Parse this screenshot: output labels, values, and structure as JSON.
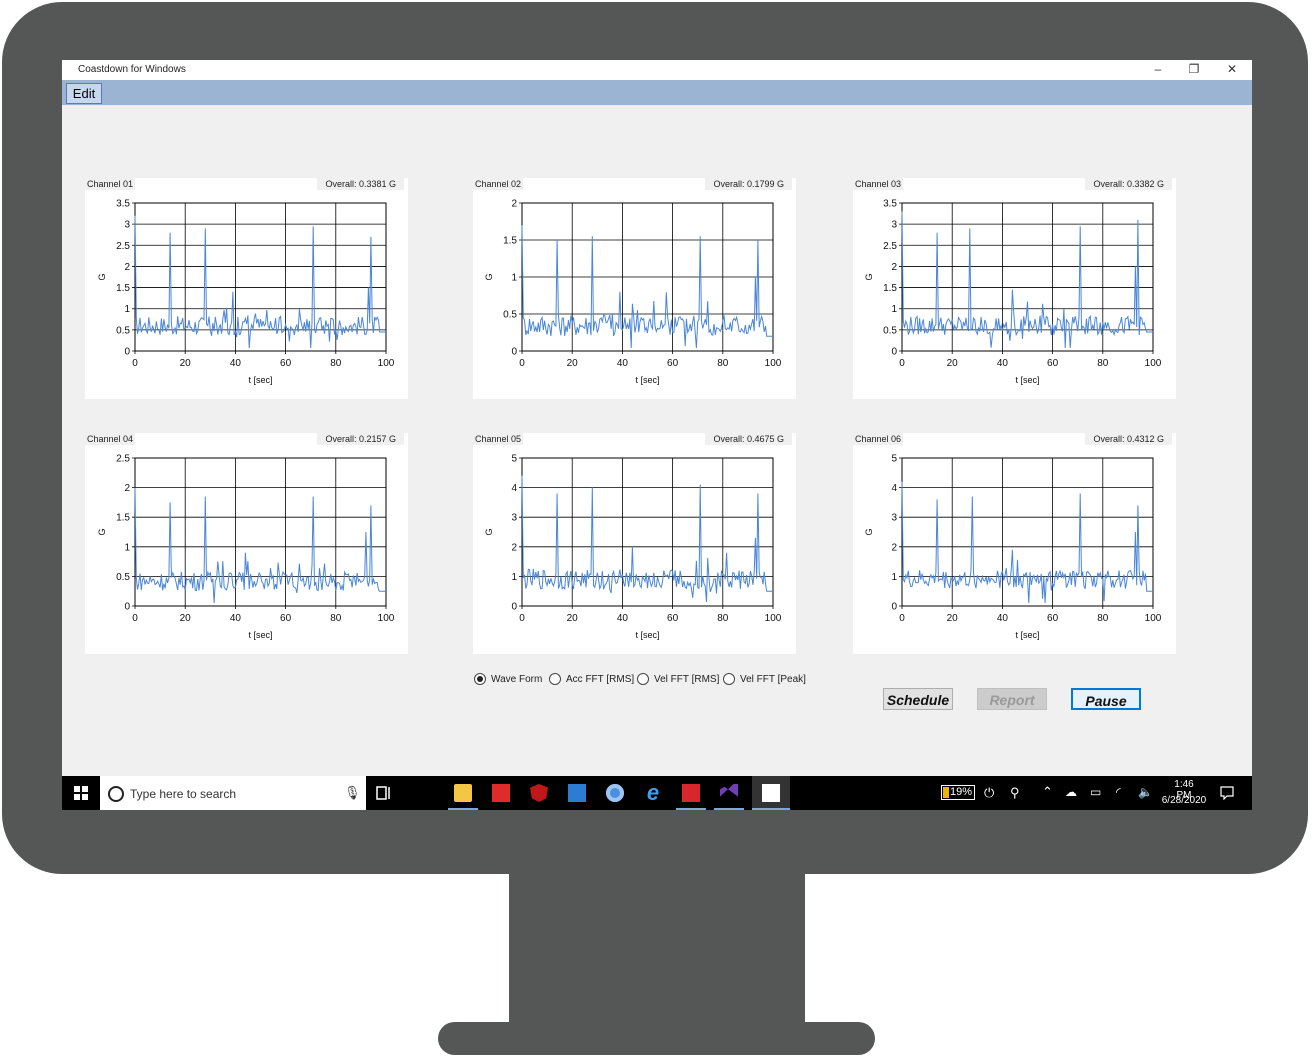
{
  "window": {
    "title": "Coastdown for Windows",
    "minimize": "–",
    "restore": "❐",
    "close": "✕"
  },
  "menu": {
    "edit": "Edit"
  },
  "chart_data": [
    {
      "type": "line",
      "channel": "Channel 01",
      "overall": "Overall: 0.3381 G",
      "xlabel": "t [sec]",
      "ylabel": "G",
      "xlim": [
        0,
        100
      ],
      "ylim": [
        0,
        3.5
      ],
      "yticks": [
        "0",
        "0.5",
        "1",
        "1.5",
        "2",
        "2.5",
        "3",
        "3.5"
      ],
      "xticks": [
        "0",
        "20",
        "40",
        "60",
        "80",
        "100"
      ],
      "grid": true,
      "series_color": "#4a86d8",
      "peaks": [
        {
          "x": 0,
          "y": 3.2
        },
        {
          "x": 14,
          "y": 2.8
        },
        {
          "x": 28,
          "y": 2.9
        },
        {
          "x": 71,
          "y": 2.95
        },
        {
          "x": 94,
          "y": 2.7
        },
        {
          "x": 93,
          "y": 1.5
        },
        {
          "x": 39,
          "y": 1.4
        }
      ],
      "baseline": 0.6,
      "noise": 0.45,
      "tail": 0.45
    },
    {
      "type": "line",
      "channel": "Channel 02",
      "overall": "Overall: 0.1799 G",
      "xlabel": "t [sec]",
      "ylabel": "G",
      "xlim": [
        0,
        100
      ],
      "ylim": [
        0,
        2
      ],
      "yticks": [
        "0",
        "0.5",
        "1",
        "1.5",
        "2"
      ],
      "xticks": [
        "0",
        "20",
        "40",
        "60",
        "80",
        "100"
      ],
      "grid": true,
      "series_color": "#4a86d8",
      "peaks": [
        {
          "x": 0,
          "y": 1.7
        },
        {
          "x": 14,
          "y": 1.5
        },
        {
          "x": 28,
          "y": 1.55
        },
        {
          "x": 71,
          "y": 1.55
        },
        {
          "x": 94,
          "y": 1.5
        },
        {
          "x": 93,
          "y": 1.0
        },
        {
          "x": 39,
          "y": 0.8
        }
      ],
      "baseline": 0.35,
      "noise": 0.3,
      "tail": 0.2
    },
    {
      "type": "line",
      "channel": "Channel 03",
      "overall": "Overall: 0.3382 G",
      "xlabel": "t [sec]",
      "ylabel": "G",
      "xlim": [
        0,
        100
      ],
      "ylim": [
        0,
        3.5
      ],
      "yticks": [
        "0",
        "0.5",
        "1",
        "1.5",
        "2",
        "2.5",
        "3",
        "3.5"
      ],
      "xticks": [
        "0",
        "20",
        "40",
        "60",
        "80",
        "100"
      ],
      "grid": true,
      "series_color": "#4a86d8",
      "peaks": [
        {
          "x": 0,
          "y": 3.3
        },
        {
          "x": 14,
          "y": 2.8
        },
        {
          "x": 27,
          "y": 2.9
        },
        {
          "x": 71,
          "y": 2.95
        },
        {
          "x": 94,
          "y": 3.1
        },
        {
          "x": 93,
          "y": 2.0
        },
        {
          "x": 44,
          "y": 1.45
        }
      ],
      "baseline": 0.6,
      "noise": 0.45,
      "tail": 0.45
    },
    {
      "type": "line",
      "channel": "Channel 04",
      "overall": "Overall: 0.2157 G",
      "xlabel": "t [sec]",
      "ylabel": "G",
      "xlim": [
        0,
        100
      ],
      "ylim": [
        0,
        2.5
      ],
      "yticks": [
        "0",
        "0.5",
        "1",
        "1.5",
        "2",
        "2.5"
      ],
      "xticks": [
        "0",
        "20",
        "40",
        "60",
        "80",
        "100"
      ],
      "grid": true,
      "series_color": "#4a86d8",
      "peaks": [
        {
          "x": 0,
          "y": 2.0
        },
        {
          "x": 14,
          "y": 1.75
        },
        {
          "x": 28,
          "y": 1.85
        },
        {
          "x": 71,
          "y": 1.85
        },
        {
          "x": 94,
          "y": 1.7
        },
        {
          "x": 92,
          "y": 1.25
        },
        {
          "x": 44,
          "y": 0.9
        }
      ],
      "baseline": 0.42,
      "noise": 0.32,
      "tail": 0.25
    },
    {
      "type": "line",
      "channel": "Channel 05",
      "overall": "Overall: 0.4675 G",
      "xlabel": "t [sec]",
      "ylabel": "G",
      "xlim": [
        0,
        100
      ],
      "ylim": [
        0,
        5
      ],
      "yticks": [
        "0",
        "1",
        "2",
        "3",
        "4",
        "5"
      ],
      "xticks": [
        "0",
        "20",
        "40",
        "60",
        "80",
        "100"
      ],
      "grid": true,
      "series_color": "#4a86d8",
      "peaks": [
        {
          "x": 0,
          "y": 4.4
        },
        {
          "x": 14,
          "y": 3.8
        },
        {
          "x": 28,
          "y": 4.0
        },
        {
          "x": 71,
          "y": 4.1
        },
        {
          "x": 94,
          "y": 3.8
        },
        {
          "x": 93,
          "y": 2.3
        },
        {
          "x": 44,
          "y": 2.0
        }
      ],
      "baseline": 0.9,
      "noise": 0.7,
      "tail": 0.5
    },
    {
      "type": "line",
      "channel": "Channel 06",
      "overall": "Overall: 0.4312 G",
      "xlabel": "t [sec]",
      "ylabel": "G",
      "xlim": [
        0,
        100
      ],
      "ylim": [
        0,
        5
      ],
      "yticks": [
        "0",
        "1",
        "2",
        "3",
        "4",
        "5"
      ],
      "xticks": [
        "0",
        "20",
        "40",
        "60",
        "80",
        "100"
      ],
      "grid": true,
      "series_color": "#4a86d8",
      "peaks": [
        {
          "x": 0,
          "y": 4.2
        },
        {
          "x": 14,
          "y": 3.6
        },
        {
          "x": 28,
          "y": 3.7
        },
        {
          "x": 71,
          "y": 3.8
        },
        {
          "x": 94,
          "y": 3.4
        },
        {
          "x": 93,
          "y": 2.5
        },
        {
          "x": 44,
          "y": 1.9
        }
      ],
      "baseline": 0.9,
      "noise": 0.65,
      "tail": 0.5
    }
  ],
  "view_options": [
    {
      "label": "Wave Form",
      "selected": true
    },
    {
      "label": "Acc FFT [RMS]",
      "selected": false
    },
    {
      "label": "Vel FFT [RMS]",
      "selected": false
    },
    {
      "label": "Vel FFT [Peak]",
      "selected": false
    }
  ],
  "buttons": {
    "schedule": "Schedule",
    "report": "Report",
    "pause": "Pause"
  },
  "taskbar": {
    "search_placeholder": "Type here to search",
    "battery": "19%",
    "time": "1:46 PM",
    "date": "6/28/2020",
    "apps": [
      "file-explorer-icon",
      "red-app-icon",
      "mcafee-icon",
      "mail-icon",
      "chrome-icon",
      "edge-icon",
      "acrobat-icon",
      "visual-studio-icon",
      "coastdown-app-icon"
    ]
  }
}
